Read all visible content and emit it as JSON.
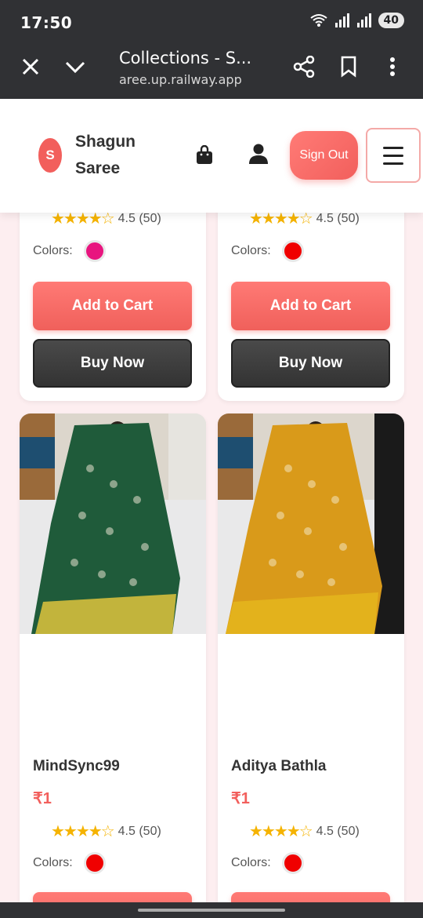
{
  "status_bar": {
    "time": "17:50",
    "battery": "40",
    "icons": [
      "wifi-calling-icon",
      "signal-icon",
      "signal-icon"
    ]
  },
  "browser": {
    "page_title": "Collections - S...",
    "url": "aree.up.railway.app",
    "icons": [
      "close-icon",
      "chevron-down-icon",
      "share-icon",
      "bookmark-icon",
      "more-vert-icon"
    ]
  },
  "header": {
    "logo_letter": "S",
    "brand_line1": "Shagun",
    "brand_line2": "Saree",
    "sign_out_label": "Sign Out",
    "icons": [
      "shopping-bag-icon",
      "user-icon",
      "menu-icon"
    ]
  },
  "colors": {
    "accent": "#f25f5c",
    "dark_button": "#3a3a3a",
    "page_bg": "#fdeef0",
    "star": "#f5b301"
  },
  "top_cards": [
    {
      "rating_text": "4.5 (50)",
      "rating": 4.5,
      "colors_label": "Colors:",
      "swatch": "#e8157f",
      "add_to_cart": "Add to Cart",
      "buy_now": "Buy Now"
    },
    {
      "rating_text": "4.5 (50)",
      "rating": 4.5,
      "colors_label": "Colors:",
      "swatch": "#f00000",
      "add_to_cart": "Add to Cart",
      "buy_now": "Buy Now"
    }
  ],
  "products": [
    {
      "name": "MindSync99",
      "price": "₹1",
      "rating_text": "4.5 (50)",
      "rating": 4.5,
      "colors_label": "Colors:",
      "swatch": "#f00000",
      "saree_color": "#1f5b3a"
    },
    {
      "name": "Aditya Bathla",
      "price": "₹1",
      "rating_text": "4.5 (50)",
      "rating": 4.5,
      "colors_label": "Colors:",
      "swatch": "#f00000",
      "saree_color": "#d99a1a"
    }
  ]
}
